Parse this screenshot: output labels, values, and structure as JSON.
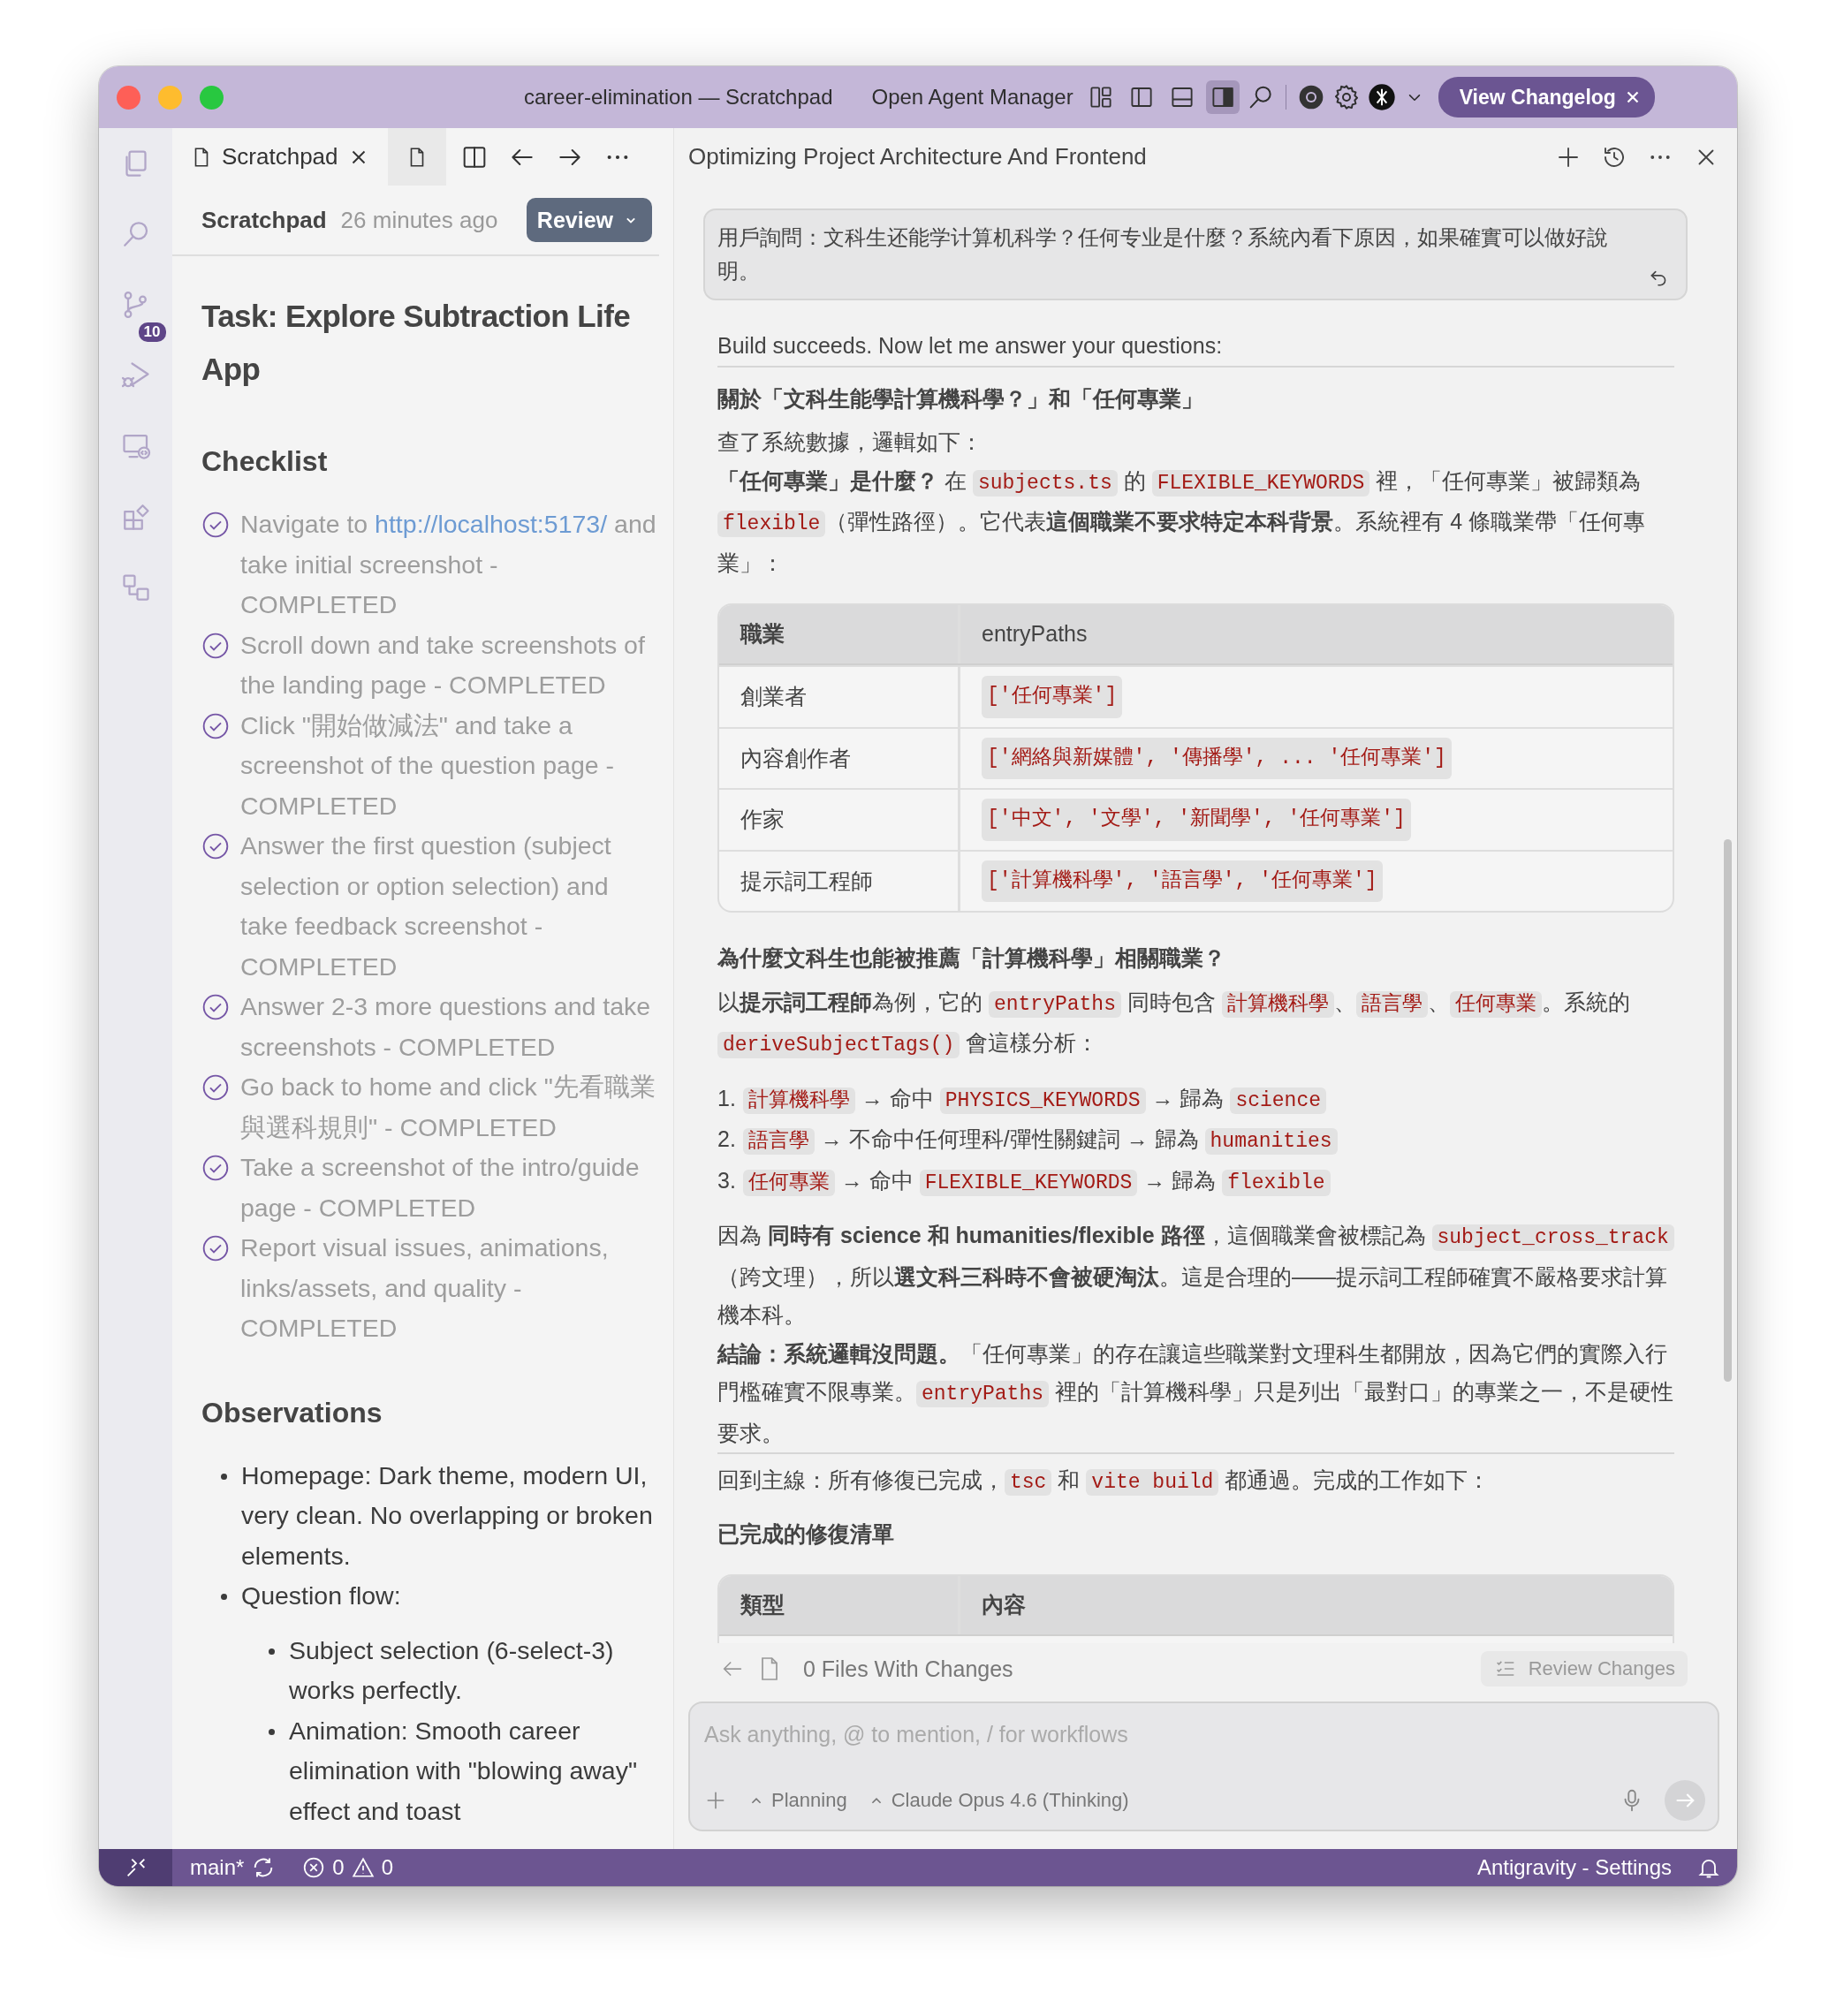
{
  "window": {
    "title": "career-elimination — Scratchpad"
  },
  "title_bar": {
    "agent_manager": "Open Agent Manager",
    "layout_toggles": [
      {
        "kind": "customize",
        "selected": false
      },
      {
        "kind": "left",
        "selected": false
      },
      {
        "kind": "bottom",
        "selected": false
      },
      {
        "kind": "right",
        "selected": true
      }
    ],
    "changelog_button": "View Changelog"
  },
  "activity_bar": [
    {
      "kind": "files"
    },
    {
      "kind": "search"
    },
    {
      "kind": "source-control",
      "badge": "10"
    },
    {
      "kind": "run"
    },
    {
      "kind": "remote"
    },
    {
      "kind": "extensions"
    },
    {
      "kind": "flow"
    }
  ],
  "editor_tabs": [
    {
      "label": "Scratchpad",
      "selected": true
    },
    {
      "selected": false
    }
  ],
  "scratchpad": {
    "title": "Scratchpad",
    "updated": "26 minutes ago",
    "review_button": "Review",
    "heading": "Task: Explore Subtraction Life App",
    "checklist": {
      "heading": "Checklist",
      "items": [
        {
          "checked": true,
          "segments": [
            {
              "kind": "text",
              "text": "Navigate to "
            },
            {
              "kind": "link",
              "text": "http://localhost:5173/"
            },
            {
              "kind": "text",
              "text": " and take initial screenshot - COMPLETED"
            }
          ]
        },
        {
          "checked": true,
          "segments": [
            {
              "kind": "text",
              "text": "Scroll down and take screenshots of the landing page - COMPLETED"
            }
          ]
        },
        {
          "checked": true,
          "segments": [
            {
              "kind": "text",
              "text": "Click \"開始做減法\" and take a screenshot of the question page - COMPLETED"
            }
          ]
        },
        {
          "checked": true,
          "segments": [
            {
              "kind": "text",
              "text": "Answer the first question (subject selection or option selection) and take feedback screenshot - COMPLETED"
            }
          ]
        },
        {
          "checked": true,
          "segments": [
            {
              "kind": "text",
              "text": "Answer 2-3 more questions and take screenshots - COMPLETED"
            }
          ]
        },
        {
          "checked": true,
          "segments": [
            {
              "kind": "text",
              "text": "Go back to home and click \"先看職業與選科規則\" - COMPLETED"
            }
          ]
        },
        {
          "checked": true,
          "segments": [
            {
              "kind": "text",
              "text": "Take a screenshot of the intro/guide page - COMPLETED"
            }
          ]
        },
        {
          "checked": true,
          "segments": [
            {
              "kind": "text",
              "text": "Report visual issues, animations, links/assets, and quality - COMPLETED"
            }
          ]
        }
      ]
    },
    "observations": {
      "heading": "Observations",
      "items": [
        {
          "text": "Homepage: Dark theme, modern UI, very clean. No overlapping or broken elements."
        },
        {
          "text": "Question flow:",
          "children": [
            {
              "text": "Subject selection (6-select-3) works perfectly."
            },
            {
              "text": "Animation: Smooth career elimination with \"blowing away\" effect and toast"
            }
          ]
        }
      ]
    }
  },
  "chat": {
    "title": "Optimizing Project Architecture And Frontend",
    "user_message": "用戶詢問：文科生还能学计算机科学？任何专业是什麼？系統內看下原因，如果確實可以做好說明。",
    "blocks": [
      {
        "kind": "paragraph",
        "segments": [
          {
            "kind": "text",
            "text": "Build succeeds. Now let me answer your questions:"
          }
        ]
      },
      {
        "kind": "divider"
      },
      {
        "kind": "heading",
        "text": "關於「文科生能學計算機科學？」和「任何專業」"
      },
      {
        "kind": "paragraph",
        "segments": [
          {
            "kind": "text",
            "text": "查了系統數據，邏輯如下："
          }
        ]
      },
      {
        "kind": "paragraph",
        "segments": [
          {
            "kind": "bold",
            "text": "「任何專業」是什麼？"
          },
          {
            "kind": "text",
            "text": " 在 "
          },
          {
            "kind": "code",
            "text": "subjects.ts"
          },
          {
            "kind": "text",
            "text": " 的 "
          },
          {
            "kind": "code",
            "text": "FLEXIBLE_KEYWORDS"
          },
          {
            "kind": "text",
            "text": " 裡，「任何專業」被歸類為 "
          },
          {
            "kind": "code",
            "text": "flexible"
          },
          {
            "kind": "text",
            "text": "（彈性路徑）。它代表"
          },
          {
            "kind": "bold",
            "text": "這個職業不要求特定本科背景"
          },
          {
            "kind": "text",
            "text": "。系統裡有 4 條職業帶「任何專業」："
          }
        ]
      },
      {
        "kind": "table",
        "columns": [
          {
            "label": "職業",
            "kind": "text"
          },
          {
            "label": "entryPaths",
            "kind": "code"
          }
        ],
        "rows": [
          [
            "創業者",
            "['任何專業']"
          ],
          [
            "內容創作者",
            "['網絡與新媒體', '傳播學', ... '任何專業']"
          ],
          [
            "作家",
            "['中文', '文學', '新聞學', '任何專業']"
          ],
          [
            "提示詞工程師",
            "['計算機科學', '語言學', '任何專業']"
          ]
        ]
      },
      {
        "kind": "heading",
        "text": "為什麼文科生也能被推薦「計算機科學」相關職業？"
      },
      {
        "kind": "paragraph",
        "segments": [
          {
            "kind": "text",
            "text": "以"
          },
          {
            "kind": "bold",
            "text": "提示詞工程師"
          },
          {
            "kind": "text",
            "text": "為例，它的 "
          },
          {
            "kind": "code",
            "text": "entryPaths"
          },
          {
            "kind": "text",
            "text": " 同時包含 "
          },
          {
            "kind": "code",
            "text": "計算機科學"
          },
          {
            "kind": "text",
            "text": "、"
          },
          {
            "kind": "code",
            "text": "語言學"
          },
          {
            "kind": "text",
            "text": "、"
          },
          {
            "kind": "code",
            "text": "任何專業"
          },
          {
            "kind": "text",
            "text": "。系統的 "
          },
          {
            "kind": "code",
            "text": "deriveSubjectTags()"
          },
          {
            "kind": "text",
            "text": " 會這樣分析："
          }
        ]
      },
      {
        "kind": "ordered_list",
        "items": [
          {
            "number": "1.",
            "segments": [
              {
                "kind": "code",
                "text": "計算機科學"
              },
              {
                "kind": "text",
                "text": " → 命中 "
              },
              {
                "kind": "code",
                "text": "PHYSICS_KEYWORDS"
              },
              {
                "kind": "text",
                "text": " → 歸為 "
              },
              {
                "kind": "code",
                "text": "science"
              }
            ]
          },
          {
            "number": "2.",
            "segments": [
              {
                "kind": "code",
                "text": "語言學"
              },
              {
                "kind": "text",
                "text": " → 不命中任何理科/彈性關鍵詞 → 歸為 "
              },
              {
                "kind": "code",
                "text": "humanities"
              }
            ]
          },
          {
            "number": "3.",
            "segments": [
              {
                "kind": "code",
                "text": "任何專業"
              },
              {
                "kind": "text",
                "text": " → 命中 "
              },
              {
                "kind": "code",
                "text": "FLEXIBLE_KEYWORDS"
              },
              {
                "kind": "text",
                "text": " → 歸為 "
              },
              {
                "kind": "code",
                "text": "flexible"
              }
            ]
          }
        ]
      },
      {
        "kind": "paragraph",
        "segments": [
          {
            "kind": "text",
            "text": "因為 "
          },
          {
            "kind": "bold",
            "text": "同時有 science 和 humanities/flexible 路徑"
          },
          {
            "kind": "text",
            "text": "，這個職業會被標記為 "
          },
          {
            "kind": "code",
            "text": "subject_cross_track"
          },
          {
            "kind": "text",
            "text": "（跨文理），所以"
          },
          {
            "kind": "bold",
            "text": "選文科三科時不會被硬淘汰"
          },
          {
            "kind": "text",
            "text": "。這是合理的——提示詞工程師確實不嚴格要求計算機本科。"
          }
        ]
      },
      {
        "kind": "paragraph",
        "segments": [
          {
            "kind": "bold",
            "text": "結論：系統邏輯沒問題。"
          },
          {
            "kind": "text",
            "text": "「任何專業」的存在讓這些職業對文理科生都開放，因為它們的實際入行門檻確實不限專業。"
          },
          {
            "kind": "code",
            "text": "entryPaths"
          },
          {
            "kind": "text",
            "text": " 裡的「計算機科學」只是列出「最對口」的專業之一，不是硬性要求。"
          }
        ]
      },
      {
        "kind": "divider"
      },
      {
        "kind": "paragraph",
        "segments": [
          {
            "kind": "text",
            "text": "回到主線：所有修復已完成，"
          },
          {
            "kind": "code",
            "text": "tsc"
          },
          {
            "kind": "text",
            "text": " 和 "
          },
          {
            "kind": "code",
            "text": "vite build"
          },
          {
            "kind": "text",
            "text": " 都通過。完成的工作如下："
          }
        ]
      },
      {
        "kind": "heading",
        "text": "已完成的修復清單"
      },
      {
        "kind": "table",
        "columns": [
          {
            "label": "類型",
            "kind": "text"
          },
          {
            "label": "內容",
            "kind": "text"
          }
        ]
      }
    ],
    "files_bar": {
      "label": "0 Files With Changes",
      "review_button": "Review Changes"
    },
    "input": {
      "placeholder": "Ask anything, @ to mention, / for workflows",
      "mode": "Planning",
      "model": "Claude Opus 4.6 (Thinking)"
    }
  },
  "status_bar": {
    "branch": "main*",
    "errors": "0",
    "warnings": "0",
    "settings": "Antigravity - Settings"
  }
}
